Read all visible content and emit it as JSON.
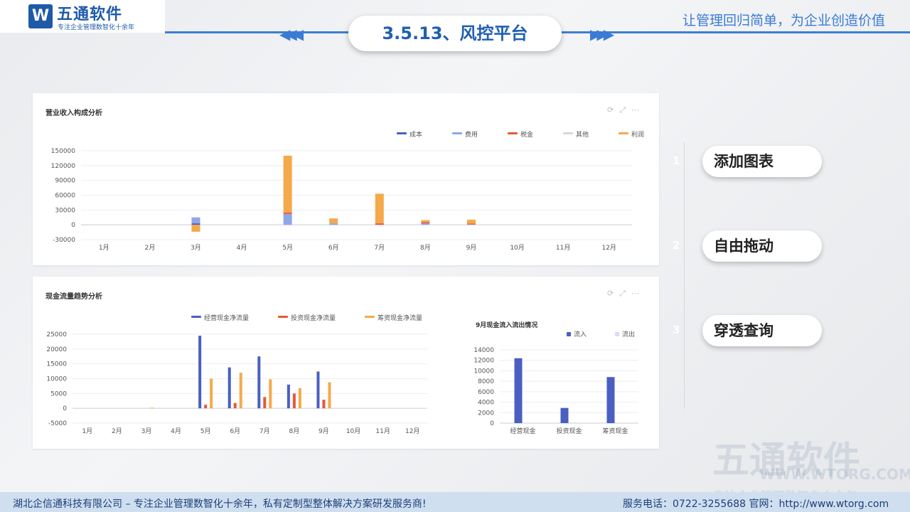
{
  "header": {
    "logo_mark": "W",
    "logo_title": "五通软件",
    "logo_sub": "专注企业管理数智化十余年",
    "slogan": "让管理回归简单，为企业创造价值",
    "page_title": "3.5.13、风控平台"
  },
  "revenue_panel": {
    "title": "营业收入构成分析",
    "chart_data": {
      "type": "bar",
      "categories": [
        "1月",
        "2月",
        "3月",
        "4月",
        "5月",
        "6月",
        "7月",
        "8月",
        "9月",
        "10月",
        "11月",
        "12月"
      ],
      "yticks": [
        "150000",
        "120000",
        "90000",
        "60000",
        "30000",
        "0",
        "-30000"
      ],
      "ylim": [
        -30000,
        150000
      ],
      "series": [
        {
          "name": "成本",
          "color": "#4a5fc1",
          "values": [
            0,
            0,
            3000,
            0,
            0,
            0,
            0,
            0,
            0,
            0,
            0,
            0
          ]
        },
        {
          "name": "费用",
          "color": "#8fa6e8",
          "values": [
            0,
            0,
            12000,
            0,
            22000,
            3000,
            0,
            3000,
            1000,
            0,
            0,
            0
          ]
        },
        {
          "name": "税金",
          "color": "#e8573c",
          "values": [
            0,
            0,
            0,
            0,
            3000,
            0,
            3000,
            2500,
            1500,
            0,
            0,
            0
          ]
        },
        {
          "name": "其他",
          "color": "#d4d7dc",
          "values": [
            0,
            0,
            0,
            0,
            0,
            0,
            0,
            0,
            0,
            0,
            0,
            0
          ]
        },
        {
          "name": "利润",
          "color": "#f5a94a",
          "values": [
            0,
            0,
            -14000,
            0,
            115000,
            10000,
            60000,
            4000,
            8000,
            0,
            0,
            0
          ]
        }
      ]
    }
  },
  "cash_panel": {
    "title": "现金流量趋势分析",
    "chart_data": {
      "type": "bar",
      "categories": [
        "1月",
        "2月",
        "3月",
        "4月",
        "5月",
        "6月",
        "7月",
        "8月",
        "9月",
        "10月",
        "11月",
        "12月"
      ],
      "yticks": [
        "25000",
        "20000",
        "15000",
        "10000",
        "5000",
        "0",
        "-5000"
      ],
      "ylim": [
        -5000,
        25000
      ],
      "series": [
        {
          "name": "经营现金净流量",
          "color": "#4a5fc1",
          "values": [
            0,
            0,
            0,
            0,
            24500,
            13800,
            17500,
            8000,
            12400,
            0,
            0,
            0
          ]
        },
        {
          "name": "投资现金净流量",
          "color": "#e8573c",
          "values": [
            0,
            0,
            0,
            0,
            1200,
            1800,
            3800,
            5000,
            2900,
            0,
            0,
            0
          ]
        },
        {
          "name": "筹资现金净流量",
          "color": "#f5a94a",
          "values": [
            0,
            0,
            200,
            0,
            10000,
            12000,
            9800,
            6800,
            8800,
            0,
            0,
            0
          ]
        }
      ]
    },
    "sub_chart": {
      "title": "9月现金流入流出情况",
      "chart_data": {
        "type": "bar",
        "categories": [
          "经营现金",
          "投资现金",
          "筹资现金"
        ],
        "yticks": [
          "14000",
          "12000",
          "10000",
          "8000",
          "6000",
          "4000",
          "2000",
          "0"
        ],
        "ylim": [
          0,
          14000
        ],
        "series": [
          {
            "name": "流入",
            "color": "#4a5fc1",
            "values": [
              12400,
              2900,
              8800
            ]
          },
          {
            "name": "流出",
            "color": "#d9dcf2",
            "values": [
              0,
              0,
              0
            ]
          }
        ]
      }
    }
  },
  "side_menu": [
    {
      "num": "1",
      "label": "添加图表"
    },
    {
      "num": "2",
      "label": "自由拖动"
    },
    {
      "num": "3",
      "label": "穿透查询"
    }
  ],
  "watermark": {
    "title": "五通软件",
    "url": "WWW.WTORG.COM",
    "tag": "专注企业管理数智化十余年"
  },
  "footer": {
    "left": "湖北企信通科技有限公司 – 专注企业管理数智化十余年，私有定制型整体解决方案研发服务商!",
    "right": "服务电话：0722-3255688  官网：http://www.wtorg.com"
  }
}
